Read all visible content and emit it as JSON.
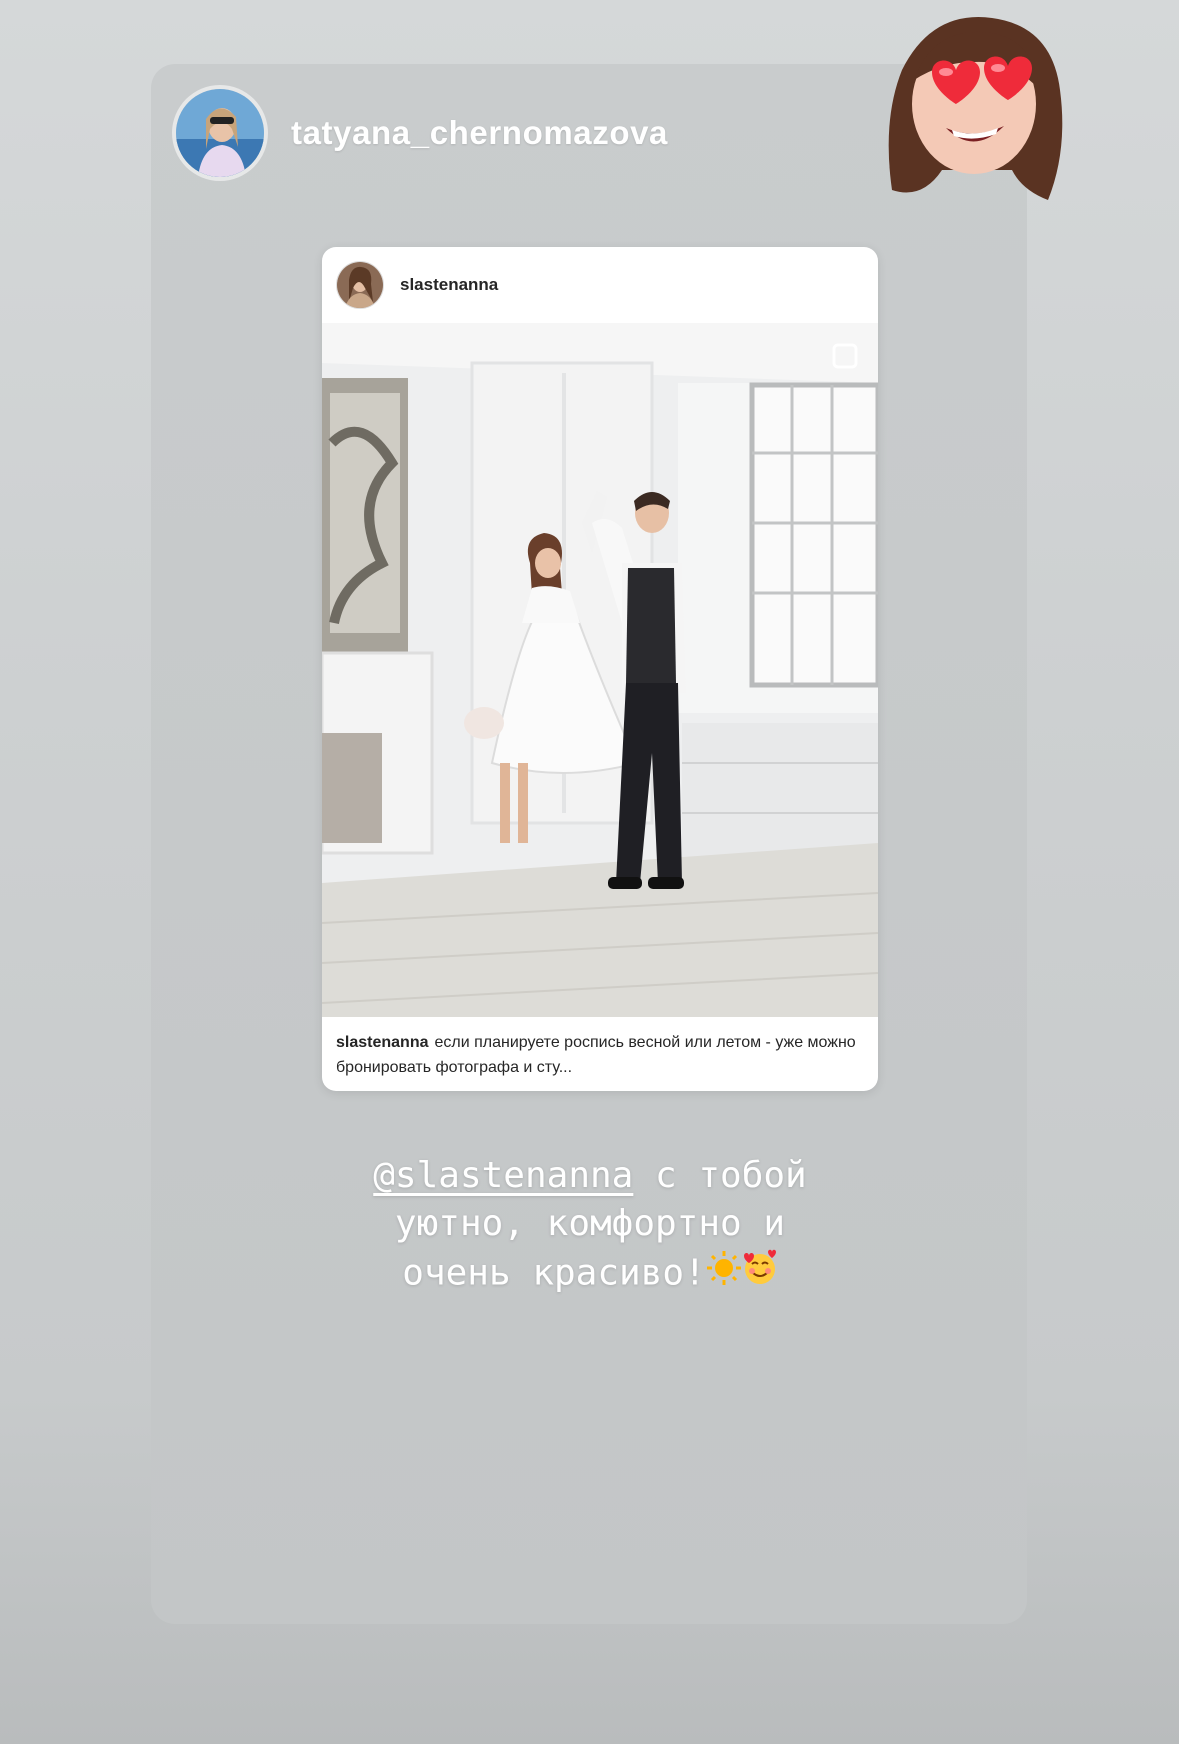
{
  "story": {
    "author": "tatyana_chernomazova",
    "shared_post": {
      "username": "slastenanna",
      "caption_user": "slastenanna",
      "caption_text": "если планируете роспись весной или летом - уже можно бронировать фотографа и сту..."
    },
    "text": {
      "mention": "@slastenanna",
      "line1_rest": " с тобой",
      "line2": "уютно, комфортно и",
      "line3": "очень красиво!"
    },
    "icons": [
      "memoji-heart-eyes-sticker",
      "sun-emoji",
      "smiling-face-with-hearts-emoji"
    ]
  },
  "colors": {
    "background": "#cdd0d1",
    "text": "#ffffff",
    "post_text": "#262626"
  }
}
